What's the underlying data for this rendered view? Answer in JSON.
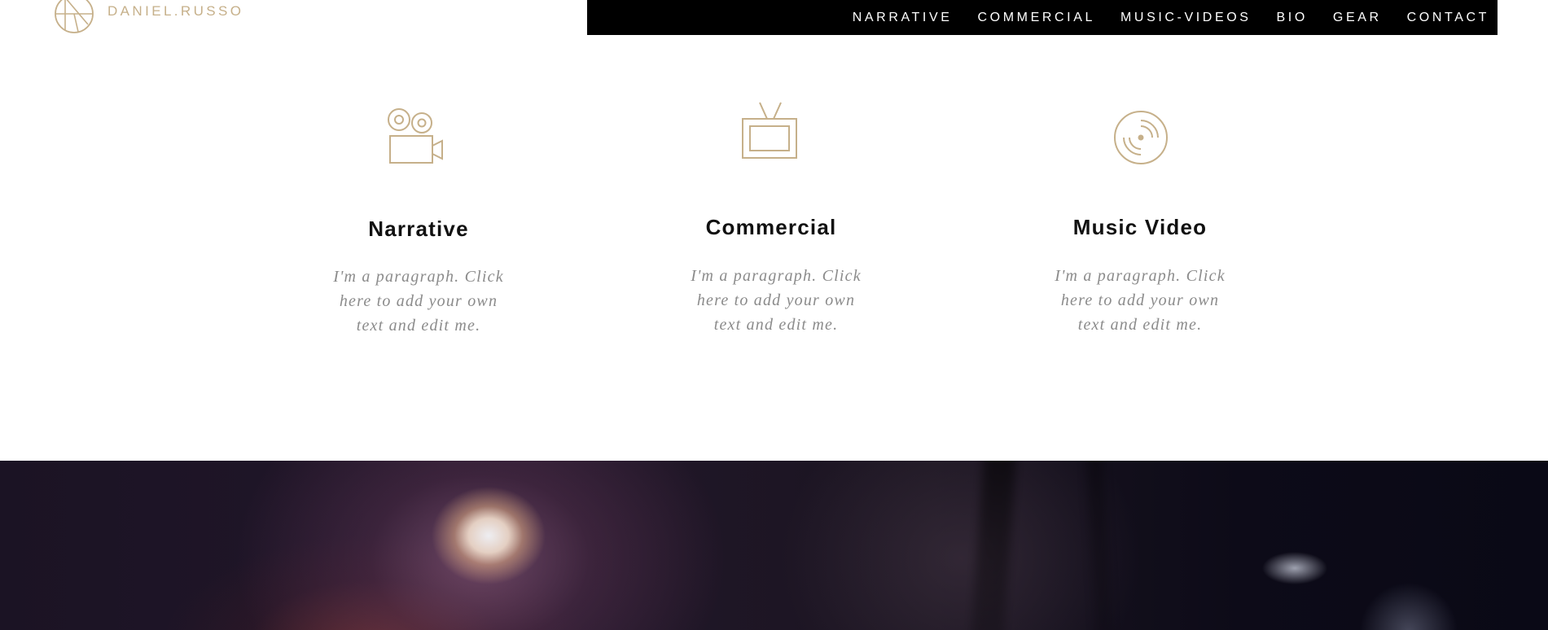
{
  "brand": {
    "name": "DANIEL.RUSSO",
    "accent_color": "#c6b08a"
  },
  "nav": {
    "items": [
      {
        "label": "NARRATIVE"
      },
      {
        "label": "COMMERCIAL"
      },
      {
        "label": "MUSIC-VIDEOS"
      },
      {
        "label": "BIO"
      },
      {
        "label": "GEAR"
      },
      {
        "label": "CONTACT"
      }
    ]
  },
  "services": [
    {
      "icon": "film-camera-icon",
      "title": "Narrative",
      "text": "I'm a paragraph. Click here to add your own text and edit me."
    },
    {
      "icon": "tv-icon",
      "title": "Commercial",
      "text": "I'm a paragraph. Click here to add your own text and edit me."
    },
    {
      "icon": "vinyl-record-icon",
      "title": "Music Video",
      "text": "I'm a paragraph. Click here to add your own text and edit me."
    }
  ]
}
